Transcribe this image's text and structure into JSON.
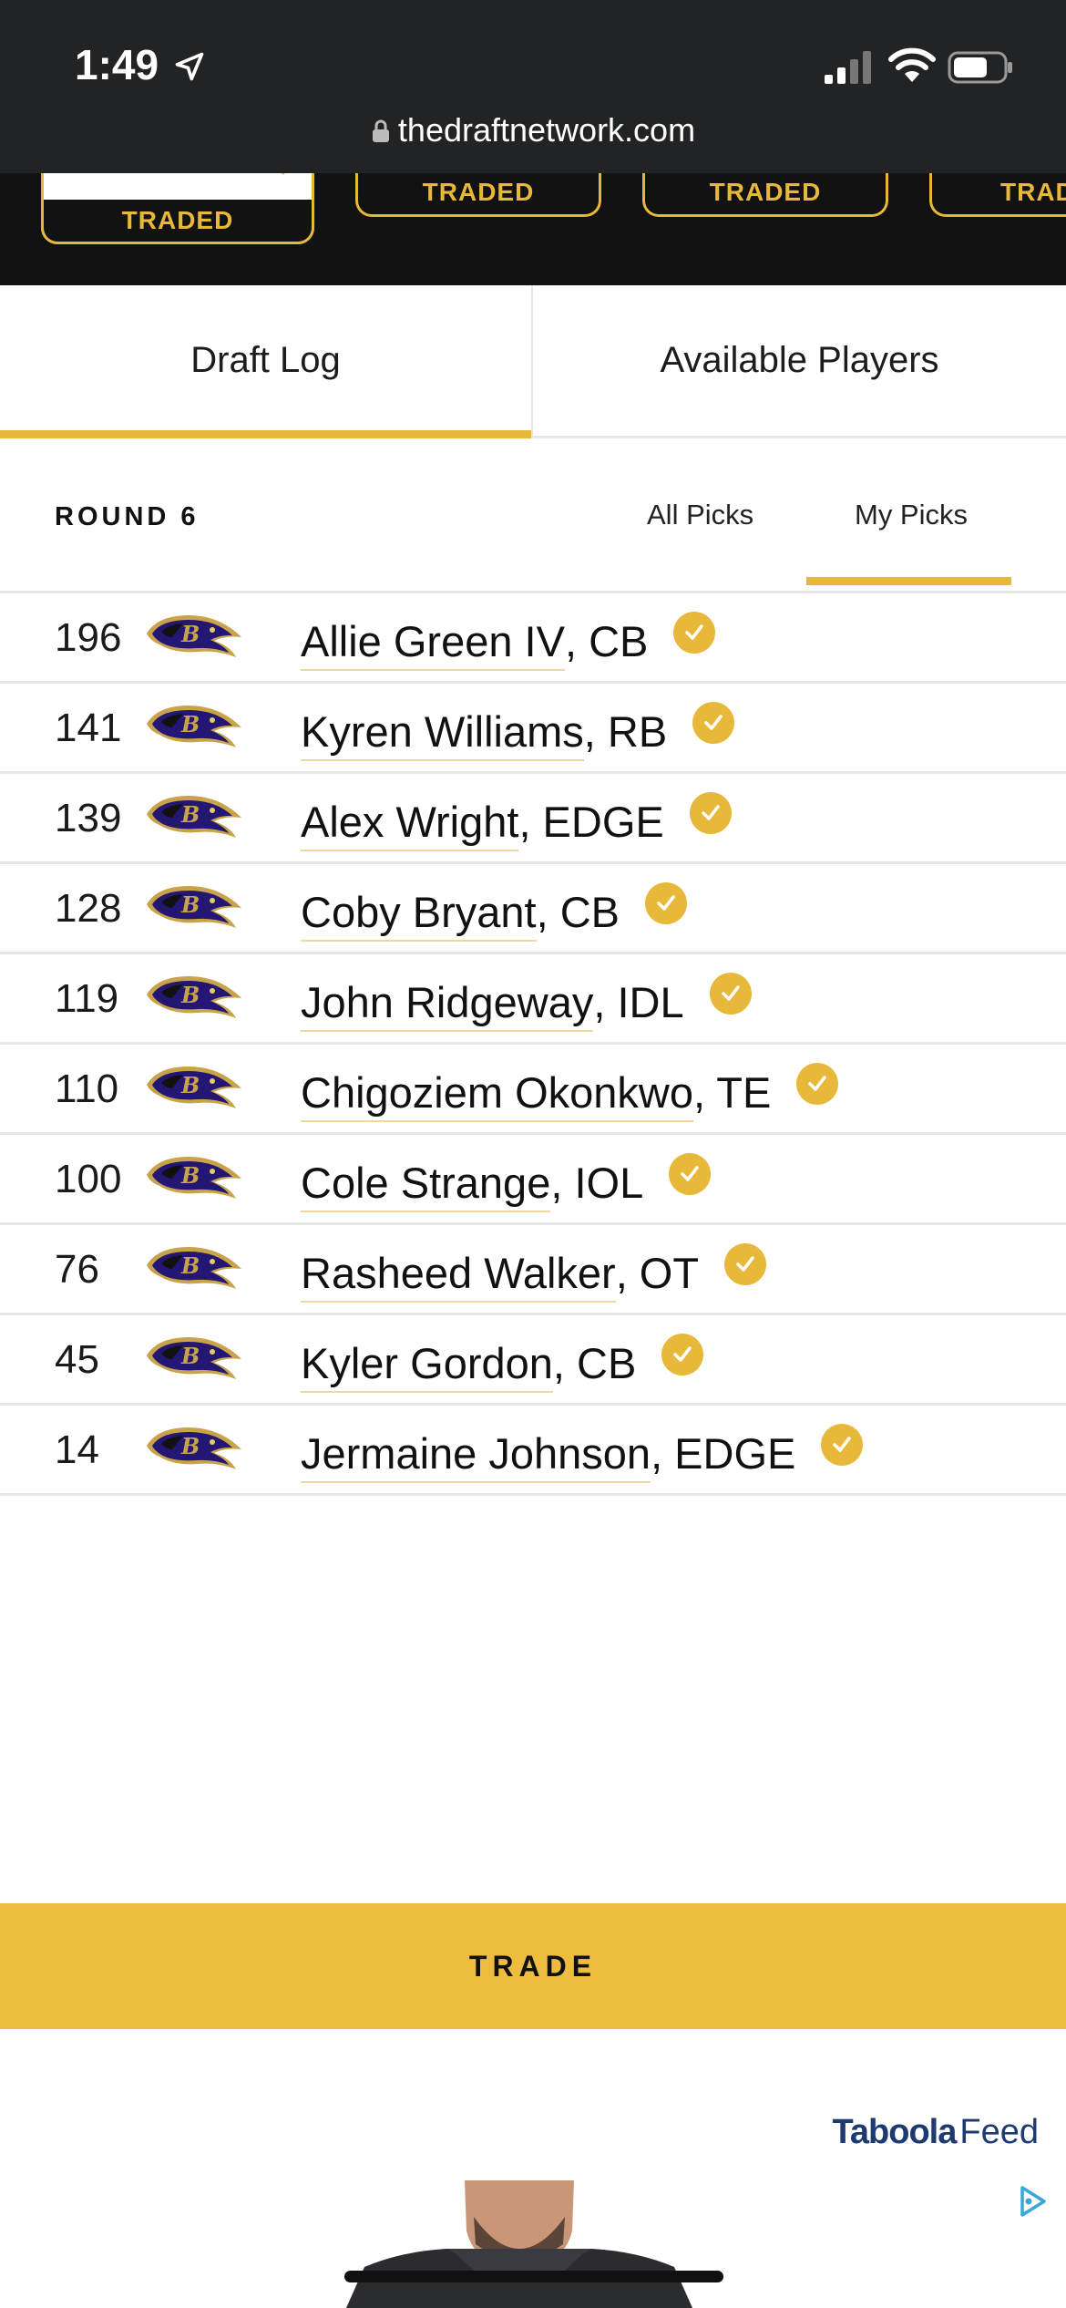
{
  "status_bar": {
    "time": "1:49",
    "url": "thedraftnetwork.com"
  },
  "traded_strip": {
    "cards": [
      "TRADED",
      "TRADED",
      "TRADED",
      "TRAD"
    ]
  },
  "tabs": [
    {
      "label": "Draft Log",
      "active": true
    },
    {
      "label": "Available Players",
      "active": false
    }
  ],
  "round": {
    "label": "ROUND 6"
  },
  "filters": [
    {
      "label": "All Picks",
      "active": false
    },
    {
      "label": "My Picks",
      "active": true
    }
  ],
  "picks": [
    {
      "number": "196",
      "player": "Allie Green IV",
      "position": ", CB"
    },
    {
      "number": "141",
      "player": "Kyren Williams",
      "position": ", RB"
    },
    {
      "number": "139",
      "player": "Alex Wright",
      "position": ", EDGE"
    },
    {
      "number": "128",
      "player": "Coby Bryant",
      "position": ", CB"
    },
    {
      "number": "119",
      "player": "John Ridgeway",
      "position": ", IDL"
    },
    {
      "number": "110",
      "player": "Chigoziem Okonkwo",
      "position": ", TE"
    },
    {
      "number": "100",
      "player": "Cole Strange",
      "position": ", IOL"
    },
    {
      "number": "76",
      "player": "Rasheed Walker",
      "position": ", OT"
    },
    {
      "number": "45",
      "player": "Kyler Gordon",
      "position": ", CB"
    },
    {
      "number": "14",
      "player": "Jermaine Johnson",
      "position": ", EDGE"
    }
  ],
  "trade_button": {
    "label": "TRADE"
  },
  "ad": {
    "brand": "Taboola",
    "feed_label": "Feed"
  },
  "colors": {
    "accent": "#e8b83a",
    "dark": "#121212",
    "team_purple": "#241773"
  },
  "icons": {
    "team_logo": "ravens-logo-icon",
    "check": "check-circle-icon"
  }
}
